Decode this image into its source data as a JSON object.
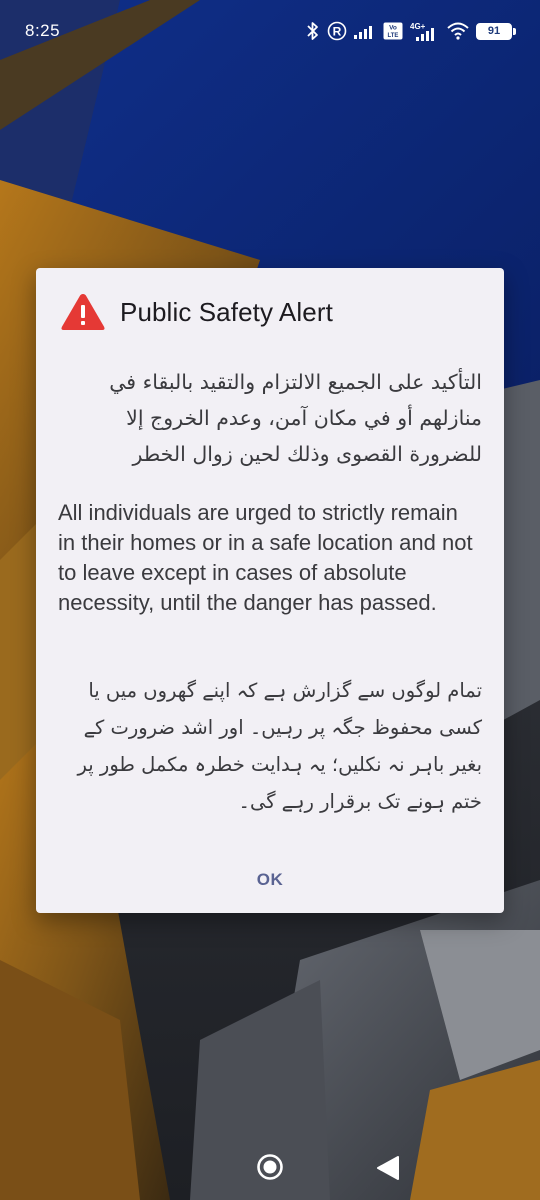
{
  "status_bar": {
    "time": "8:25",
    "network_badge": "R",
    "lte_label": "LTE",
    "network_type": "4G+",
    "battery_level": "91",
    "icons": [
      "bluetooth-icon",
      "roaming-icon",
      "signal-icon",
      "volte-icon",
      "signal-4g-icon",
      "wifi-icon",
      "battery-icon"
    ]
  },
  "dialog": {
    "icon": "warning-triangle-icon",
    "title": "Public Safety Alert",
    "message_arabic": "التأكيد على الجميع الالتزام والتقيد بالبقاء في منازلهم أو في مكان آمن، وعدم الخروج إلا للضرورة القصوى وذلك لحين زوال الخطر",
    "message_english": "All individuals are urged to strictly remain in their homes or in a safe location and not to leave except in cases of absolute necessity, until the danger has passed.",
    "message_urdu": "تمام لوگوں سے گزارش ہے کہ اپنے گھروں میں یا کسی محفوظ جگہ پر رہیں۔ اور اشد ضرورت کے بغیر باہر نہ نکلیں؛ یہ ہدایت خطرہ مکمل طور پر ختم ہونے تک برقرار رہے گی۔",
    "ok_label": "OK"
  },
  "nav_bar": {
    "icons": [
      "home-icon",
      "back-icon"
    ]
  },
  "colors": {
    "dialog_bg": "#f2f0f5",
    "warning_red": "#e53935",
    "button_text": "#5a6392"
  }
}
